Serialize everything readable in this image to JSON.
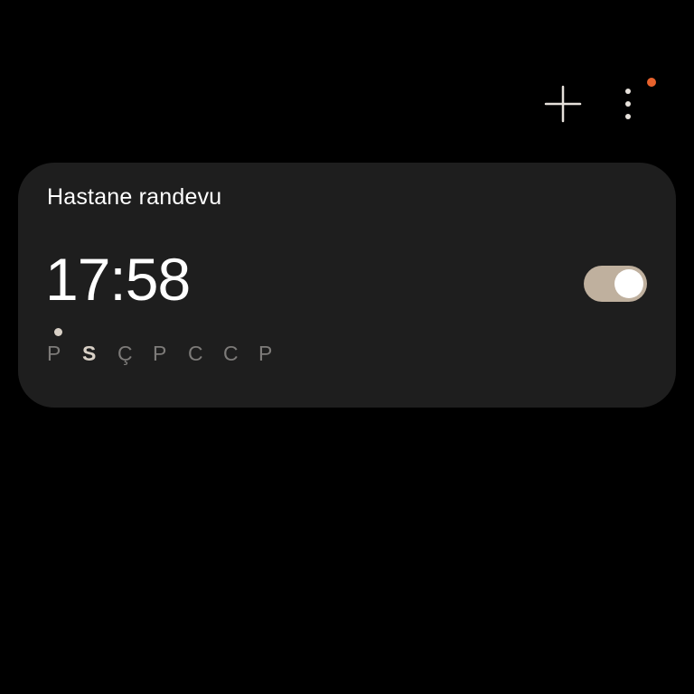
{
  "toolbar": {
    "add_icon": "plus-icon",
    "more_icon": "more-vertical-icon",
    "notification_color": "#e8622c"
  },
  "alarm": {
    "name": "Hastane randevu",
    "time": "17:58",
    "enabled": true,
    "toggle_color": "#bfb09e",
    "days": [
      {
        "label": "P",
        "active": false
      },
      {
        "label": "S",
        "active": true
      },
      {
        "label": "Ç",
        "active": false
      },
      {
        "label": "P",
        "active": false
      },
      {
        "label": "C",
        "active": false
      },
      {
        "label": "C",
        "active": false
      },
      {
        "label": "P",
        "active": false
      }
    ]
  }
}
